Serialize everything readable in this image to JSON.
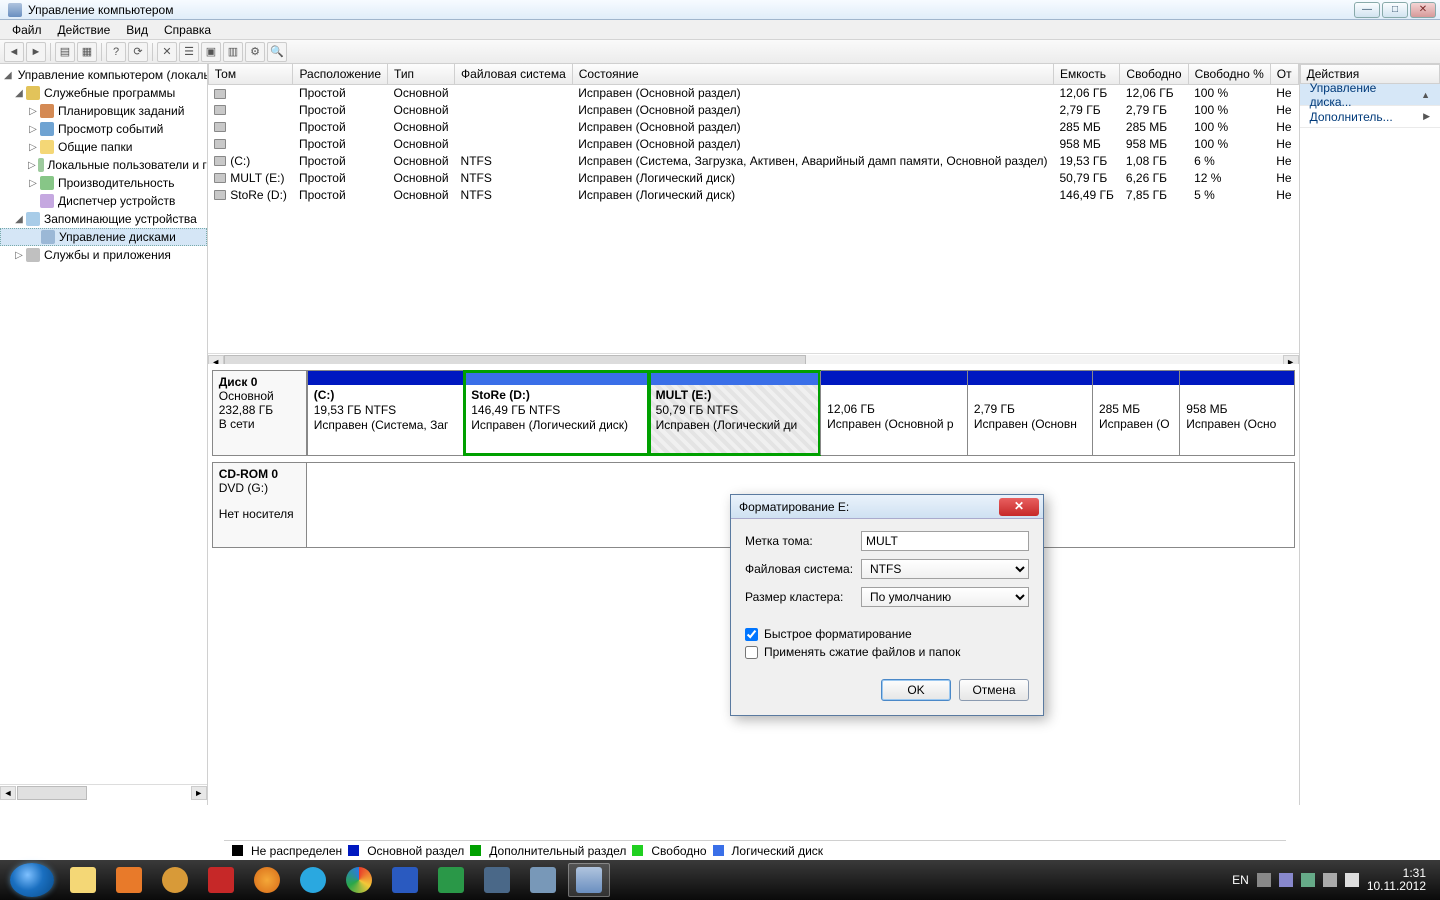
{
  "window": {
    "title": "Управление компьютером"
  },
  "menu": {
    "file": "Файл",
    "action": "Действие",
    "view": "Вид",
    "help": "Справка"
  },
  "tree": {
    "root": "Управление компьютером (локаль",
    "sysTools": "Служебные программы",
    "scheduler": "Планировщик заданий",
    "eventViewer": "Просмотр событий",
    "sharedFolders": "Общие папки",
    "localUsers": "Локальные пользователи и г",
    "performance": "Производительность",
    "deviceMgr": "Диспетчер устройств",
    "storage": "Запоминающие устройства",
    "diskMgmt": "Управление дисками",
    "services": "Службы и приложения"
  },
  "columns": {
    "volume": "Том",
    "layout": "Расположение",
    "type": "Тип",
    "fs": "Файловая система",
    "status": "Состояние",
    "capacity": "Емкость",
    "free": "Свободно",
    "freePct": "Свободно %",
    "fault": "От"
  },
  "volumes": [
    {
      "name": "",
      "layout": "Простой",
      "type": "Основной",
      "fs": "",
      "status": "Исправен (Основной раздел)",
      "capacity": "12,06 ГБ",
      "free": "12,06 ГБ",
      "pct": "100 %",
      "fault": "Не"
    },
    {
      "name": "",
      "layout": "Простой",
      "type": "Основной",
      "fs": "",
      "status": "Исправен (Основной раздел)",
      "capacity": "2,79 ГБ",
      "free": "2,79 ГБ",
      "pct": "100 %",
      "fault": "Не"
    },
    {
      "name": "",
      "layout": "Простой",
      "type": "Основной",
      "fs": "",
      "status": "Исправен (Основной раздел)",
      "capacity": "285 МБ",
      "free": "285 МБ",
      "pct": "100 %",
      "fault": "Не"
    },
    {
      "name": "",
      "layout": "Простой",
      "type": "Основной",
      "fs": "",
      "status": "Исправен (Основной раздел)",
      "capacity": "958 МБ",
      "free": "958 МБ",
      "pct": "100 %",
      "fault": "Не"
    },
    {
      "name": "(C:)",
      "layout": "Простой",
      "type": "Основной",
      "fs": "NTFS",
      "status": "Исправен (Система, Загрузка, Активен, Аварийный дамп памяти, Основной раздел)",
      "capacity": "19,53 ГБ",
      "free": "1,08 ГБ",
      "pct": "6 %",
      "fault": "Не"
    },
    {
      "name": "MULT (E:)",
      "layout": "Простой",
      "type": "Основной",
      "fs": "NTFS",
      "status": "Исправен (Логический диск)",
      "capacity": "50,79 ГБ",
      "free": "6,26 ГБ",
      "pct": "12 %",
      "fault": "Не"
    },
    {
      "name": "StoRe (D:)",
      "layout": "Простой",
      "type": "Основной",
      "fs": "NTFS",
      "status": "Исправен (Логический диск)",
      "capacity": "146,49 ГБ",
      "free": "7,85 ГБ",
      "pct": "5 %",
      "fault": "Не"
    }
  ],
  "disk0": {
    "header": {
      "name": "Диск 0",
      "type": "Основной",
      "size": "232,88 ГБ",
      "state": "В сети"
    },
    "parts": {
      "c": {
        "title": "(C:)",
        "size": "19,53 ГБ NTFS",
        "status": "Исправен (Система, Заг"
      },
      "d": {
        "title": "StoRe  (D:)",
        "size": "146,49 ГБ NTFS",
        "status": "Исправен (Логический диск)"
      },
      "e": {
        "title": "MULT  (E:)",
        "size": "50,79 ГБ NTFS",
        "status": "Исправен (Логический ди"
      },
      "p1": {
        "title": "",
        "size": "12,06 ГБ",
        "status": "Исправен (Основной р"
      },
      "p2": {
        "title": "",
        "size": "2,79 ГБ",
        "status": "Исправен (Основн"
      },
      "p3": {
        "title": "",
        "size": "285 МБ",
        "status": "Исправен (О"
      },
      "p4": {
        "title": "",
        "size": "958 МБ",
        "status": "Исправен (Осно"
      }
    }
  },
  "cdrom": {
    "header": {
      "name": "CD-ROM 0",
      "type": "DVD (G:)",
      "state": "Нет носителя"
    }
  },
  "legend": {
    "unalloc": "Не распределен",
    "primary": "Основной раздел",
    "extended": "Дополнительный раздел",
    "free": "Свободно",
    "logical": "Логический диск"
  },
  "actions": {
    "header": "Действия",
    "link1": "Управление диска...",
    "link2": "Дополнитель..."
  },
  "dialog": {
    "title": "Форматирование E:",
    "label_volume": "Метка тома:",
    "value_volume": "MULT",
    "label_fs": "Файловая система:",
    "value_fs": "NTFS",
    "label_cluster": "Размер кластера:",
    "value_cluster": "По умолчанию",
    "quick": "Быстрое форматирование",
    "compress": "Применять сжатие файлов и папок",
    "ok": "OK",
    "cancel": "Отмена"
  },
  "taskbar": {
    "lang": "EN",
    "time": "1:31",
    "date": "10.11.2012"
  }
}
